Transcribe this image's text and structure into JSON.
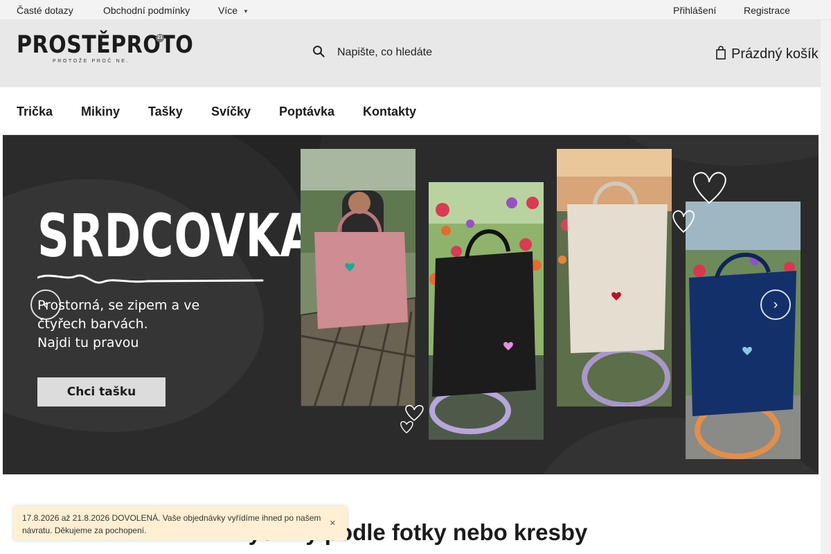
{
  "topbar": {
    "links": [
      "Časté dotazy",
      "Obchodní podmínky",
      "Více"
    ],
    "more_caret_icon": "chevron-down-icon",
    "login": "Přihlášení",
    "register": "Registrace"
  },
  "header": {
    "logo_text": "PROSTĚPROTO",
    "logo_tagline": "PROTOŽE PROČ NE.",
    "logo_badge": "21",
    "search_placeholder": "Napište, co hledáte",
    "search_icon": "search-icon",
    "cart_label": "Prázdný košík",
    "cart_icon": "shopping-bag-icon"
  },
  "nav": {
    "items": [
      "Trička",
      "Mikiny",
      "Tašky",
      "Svíčky",
      "Poptávka",
      "Kontakty"
    ]
  },
  "banner": {
    "title": "SRDCOVKA",
    "lines": [
      "Prostorná, se zipem a ve",
      "čtyřech barvách.",
      "Najdi tu pravou"
    ],
    "cta": "Chci tašku",
    "prev_icon": "chevron-left-icon",
    "next_icon": "chevron-right-icon",
    "bag_colors": [
      "#cf8c92",
      "#1c1c1c",
      "#e4ddd0",
      "#13306b"
    ],
    "heart_colors": [
      "#1fa893",
      "#e98fe0",
      "#b3142a",
      "#8ec6e6"
    ]
  },
  "main": {
    "heading": "Výšivky podle fotky nebo kresby"
  },
  "notice": {
    "text": "17.8.2026 až 21.8.2026 DOVOLENÁ. Vaše objednávky vyřídíme ihned po našem návratu. Děkujeme za pochopení.",
    "close_icon": "close-icon"
  },
  "colors": {
    "topbar_bg": "#f3f3f3",
    "header_bg": "#e8e8e8",
    "banner_bg": "#2a2a2a",
    "notice_bg": "#fff0d4",
    "cta_bg": "#dcdcdc"
  }
}
